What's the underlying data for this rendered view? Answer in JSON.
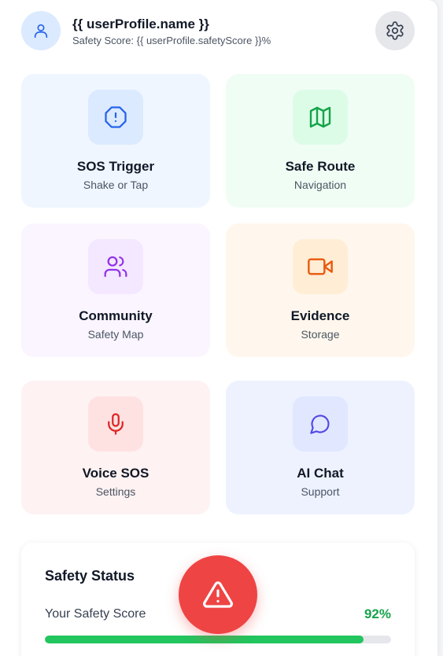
{
  "header": {
    "profile_name": "{{ userProfile.name }}",
    "safety_score_text": "Safety Score: {{ userProfile.safetyScore }}%",
    "avatar_icon": "user-icon",
    "settings_icon": "gear-icon"
  },
  "cards": [
    {
      "title": "SOS Trigger",
      "subtitle": "Shake or Tap",
      "icon": "alert-octagon-icon",
      "bg": "#eff6ff",
      "tile": "#dbeafe",
      "color": "#2563eb"
    },
    {
      "title": "Safe Route",
      "subtitle": "Navigation",
      "icon": "map-icon",
      "bg": "#f0fdf4",
      "tile": "#dcfce7",
      "color": "#16a34a"
    },
    {
      "title": "Community",
      "subtitle": "Safety Map",
      "icon": "users-icon",
      "bg": "#faf5ff",
      "tile": "#f3e8ff",
      "color": "#9333ea"
    },
    {
      "title": "Evidence",
      "subtitle": "Storage",
      "icon": "video-camera-icon",
      "bg": "#fff7ed",
      "tile": "#ffedd5",
      "color": "#ea580c"
    },
    {
      "title": "Voice SOS",
      "subtitle": "Settings",
      "icon": "microphone-icon",
      "bg": "#fef2f2",
      "tile": "#fee2e2",
      "color": "#dc2626"
    },
    {
      "title": "AI Chat",
      "subtitle": "Support",
      "icon": "chat-bubble-icon",
      "bg": "#eef2ff",
      "tile": "#e0e7ff",
      "color": "#4f46e5"
    }
  ],
  "status": {
    "title": "Safety Status",
    "score_label": "Your Safety Score",
    "score_value": "92%",
    "score_fraction": 0.92,
    "bar_color": "#22c55e"
  },
  "sos_button": {
    "icon": "warning-triangle-icon",
    "color": "#ef4444"
  }
}
